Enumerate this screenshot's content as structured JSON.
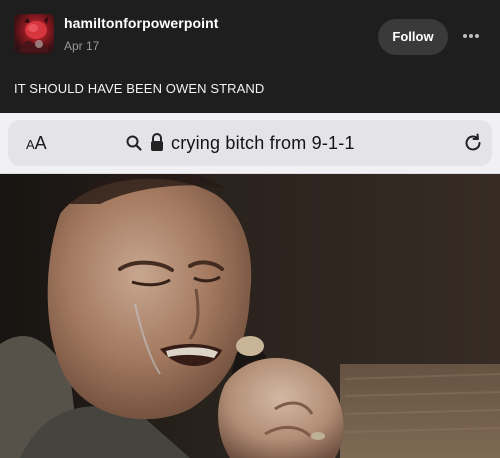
{
  "post": {
    "username": "hamiltonforpowerpoint",
    "date": "Apr 17",
    "follow_label": "Follow",
    "more_icon": "more-horizontal-icon",
    "caption": "IT SHOULD HAVE BEEN OWEN STRAND"
  },
  "browser": {
    "aa_small": "A",
    "aa_large": "A",
    "search_icon": "search-icon",
    "lock_icon": "lock-icon",
    "url_text": "crying bitch from 9-1-1",
    "reload_icon": "reload-icon"
  },
  "colors": {
    "background": "#1e1e1e",
    "follow_button": "#3a3a3a",
    "browser_bar": "#f1f1f3",
    "url_pill": "#e4e4e8"
  }
}
